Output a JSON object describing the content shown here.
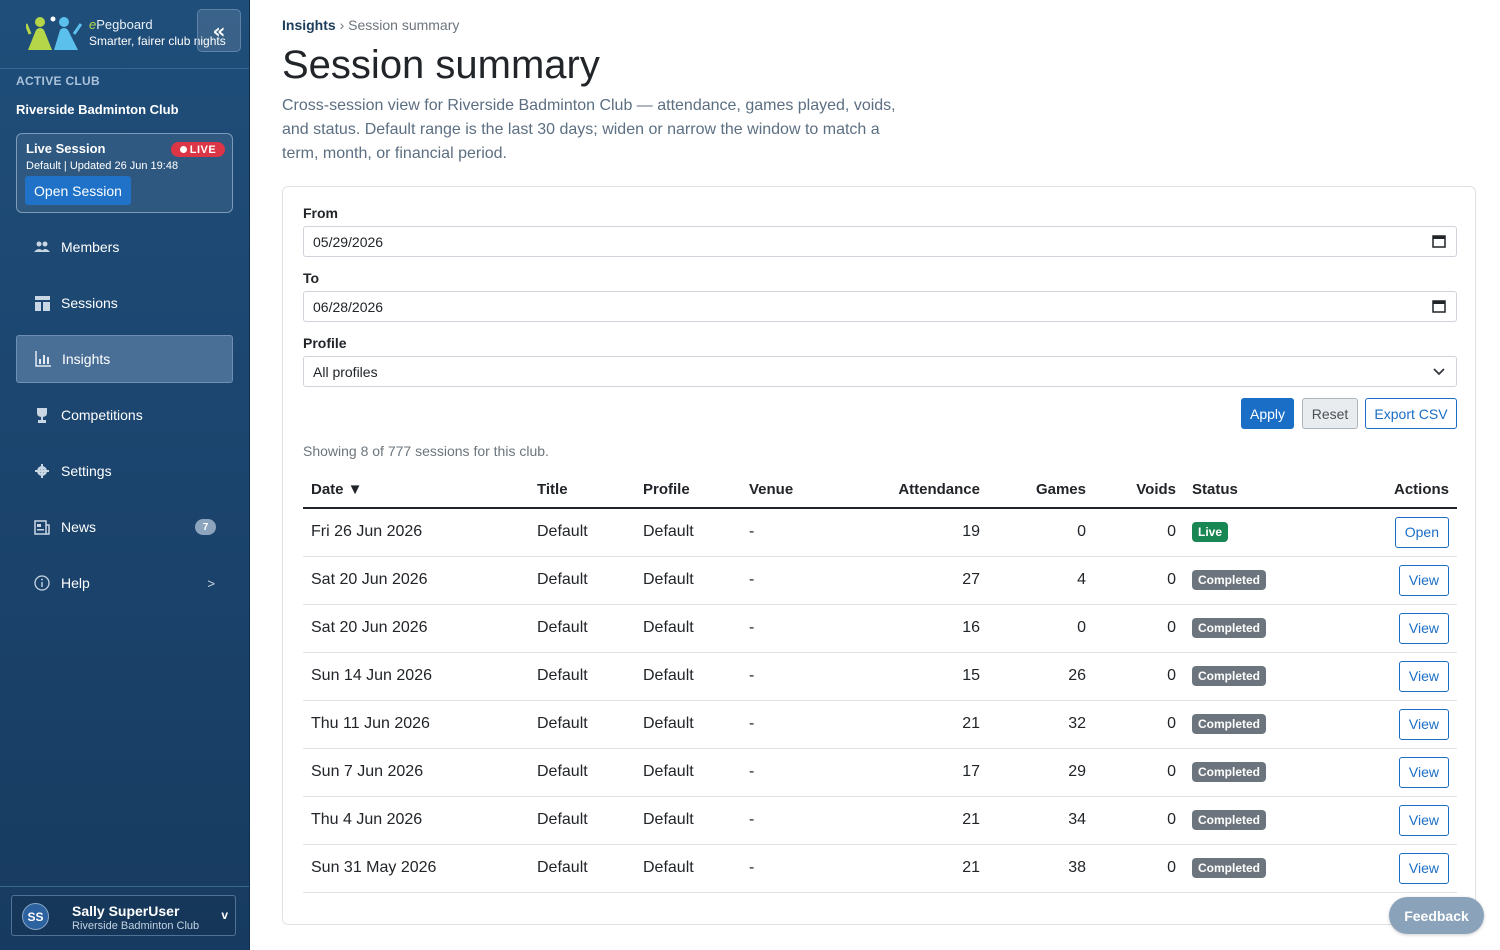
{
  "brand": {
    "name_prefix": "e",
    "name_rest": "Pegboard",
    "tagline": "Smarter, fairer club nights",
    "collapse_icon": "«"
  },
  "sidebar": {
    "active_club_label": "ACTIVE CLUB",
    "club_name": "Riverside Badminton Club",
    "live_session": {
      "title": "Live Session",
      "badge": "LIVE",
      "meta": "Default | Updated 26 Jun 19:48",
      "button": "Open Session"
    },
    "items": [
      {
        "label": "Members",
        "icon": "members-icon"
      },
      {
        "label": "Sessions",
        "icon": "sessions-icon"
      },
      {
        "label": "Insights",
        "icon": "insights-icon",
        "active": true
      },
      {
        "label": "Competitions",
        "icon": "trophy-icon"
      },
      {
        "label": "Settings",
        "icon": "gear-icon"
      },
      {
        "label": "News",
        "icon": "news-icon",
        "count": "7"
      },
      {
        "label": "Help",
        "icon": "help-icon",
        "chevron": ">"
      }
    ],
    "user": {
      "initials": "SS",
      "name": "Sally SuperUser",
      "club": "Riverside Badminton Club",
      "caret": "v"
    }
  },
  "breadcrumb": {
    "parent": "Insights",
    "separator": "›",
    "current": "Session summary"
  },
  "page": {
    "title": "Session summary",
    "description": "Cross-session view for Riverside Badminton Club — attendance, games played, voids, and status. Default range is the last 30 days; widen or narrow the window to match a term, month, or financial period."
  },
  "filters": {
    "from_label": "From",
    "from_value": "05/29/2026",
    "to_label": "To",
    "to_value": "06/28/2026",
    "profile_label": "Profile",
    "profile_value": "All profiles",
    "apply": "Apply",
    "reset": "Reset",
    "export": "Export CSV"
  },
  "summary_text": "Showing 8 of 777 sessions for this club.",
  "table": {
    "headers": [
      "Date ▼",
      "Title",
      "Profile",
      "Venue",
      "Attendance",
      "Games",
      "Voids",
      "Status",
      "Actions"
    ],
    "rows": [
      {
        "date": "Fri 26 Jun 2026",
        "title": "Default",
        "profile": "Default",
        "venue": "-",
        "attendance": "19",
        "games": "0",
        "voids": "0",
        "status": "Live",
        "action": "Open"
      },
      {
        "date": "Sat 20 Jun 2026",
        "title": "Default",
        "profile": "Default",
        "venue": "-",
        "attendance": "27",
        "games": "4",
        "voids": "0",
        "status": "Completed",
        "action": "View"
      },
      {
        "date": "Sat 20 Jun 2026",
        "title": "Default",
        "profile": "Default",
        "venue": "-",
        "attendance": "16",
        "games": "0",
        "voids": "0",
        "status": "Completed",
        "action": "View"
      },
      {
        "date": "Sun 14 Jun 2026",
        "title": "Default",
        "profile": "Default",
        "venue": "-",
        "attendance": "15",
        "games": "26",
        "voids": "0",
        "status": "Completed",
        "action": "View"
      },
      {
        "date": "Thu 11 Jun 2026",
        "title": "Default",
        "profile": "Default",
        "venue": "-",
        "attendance": "21",
        "games": "32",
        "voids": "0",
        "status": "Completed",
        "action": "View"
      },
      {
        "date": "Sun 7 Jun 2026",
        "title": "Default",
        "profile": "Default",
        "venue": "-",
        "attendance": "17",
        "games": "29",
        "voids": "0",
        "status": "Completed",
        "action": "View"
      },
      {
        "date": "Thu 4 Jun 2026",
        "title": "Default",
        "profile": "Default",
        "venue": "-",
        "attendance": "21",
        "games": "34",
        "voids": "0",
        "status": "Completed",
        "action": "View"
      },
      {
        "date": "Sun 31 May 2026",
        "title": "Default",
        "profile": "Default",
        "venue": "-",
        "attendance": "21",
        "games": "38",
        "voids": "0",
        "status": "Completed",
        "action": "View"
      }
    ]
  },
  "feedback": "Feedback",
  "colors": {
    "sidebar_bg": "#1c4670",
    "primary": "#1a6ec6",
    "live": "#dc3545",
    "status_live": "#198754",
    "status_completed": "#6c757d"
  }
}
